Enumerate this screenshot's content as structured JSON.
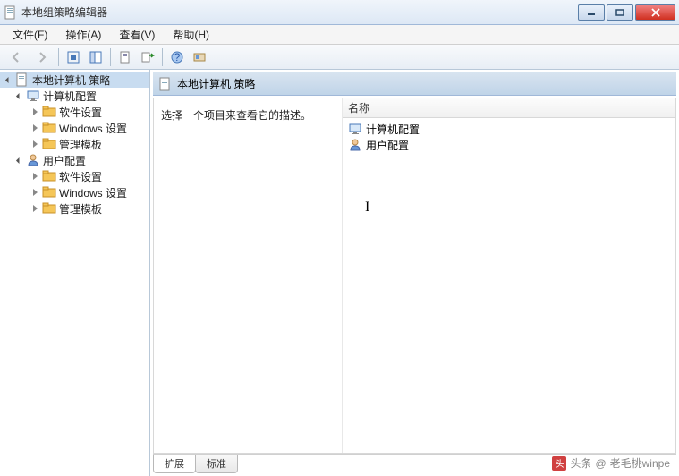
{
  "window": {
    "title": "本地组策略编辑器"
  },
  "menu": {
    "file": "文件(F)",
    "action": "操作(A)",
    "view": "查看(V)",
    "help": "帮助(H)"
  },
  "tree": {
    "root": "本地计算机 策略",
    "computer": "计算机配置",
    "user": "用户配置",
    "software": "软件设置",
    "windows": "Windows 设置",
    "templates": "管理模板"
  },
  "content": {
    "header": "本地计算机 策略",
    "description": "选择一个项目来查看它的描述。",
    "name_col": "名称",
    "items": {
      "computer": "计算机配置",
      "user": "用户配置"
    }
  },
  "tabs": {
    "extended": "扩展",
    "standard": "标准"
  },
  "watermark": {
    "prefix": "头条",
    "at": "@",
    "author": "老毛桃winpe"
  }
}
